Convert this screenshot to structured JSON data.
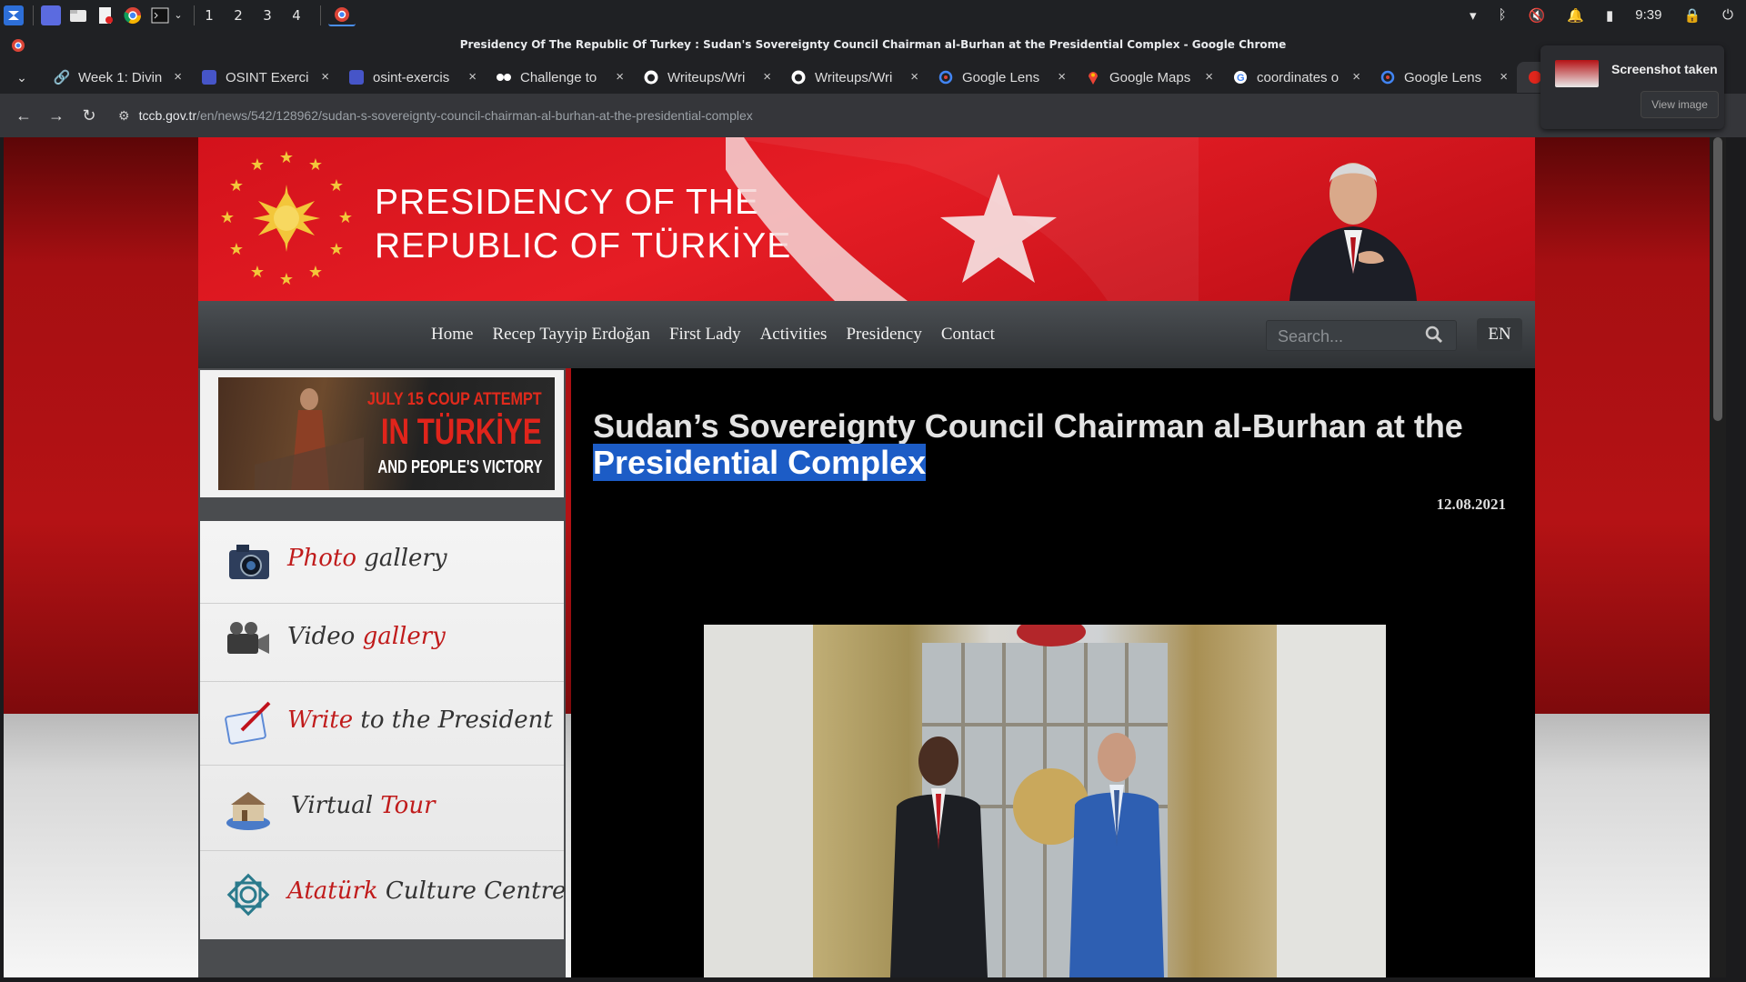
{
  "taskbar": {
    "workspaces": [
      "1",
      "2",
      "3",
      "4"
    ],
    "time": "9:39"
  },
  "window": {
    "title": "Presidency Of The Republic Of Turkey : Sudan's Sovereignty Council Chairman al-Burhan at the Presidential Complex - Google Chrome"
  },
  "tabs": [
    {
      "label": "Week 1: Divin",
      "icon": "link-icon"
    },
    {
      "label": "OSINT Exerci",
      "icon": "osint-icon"
    },
    {
      "label": "osint-exercis",
      "icon": "osint-icon"
    },
    {
      "label": "Challenge to",
      "icon": "challenge-icon"
    },
    {
      "label": "Writeups/Wri",
      "icon": "github-icon"
    },
    {
      "label": "Writeups/Wri",
      "icon": "github-icon"
    },
    {
      "label": "Google Lens",
      "icon": "google-lens-icon"
    },
    {
      "label": "Google Maps",
      "icon": "google-maps-icon"
    },
    {
      "label": "coordinates o",
      "icon": "google-icon"
    },
    {
      "label": "Google Lens",
      "icon": "google-lens-icon"
    }
  ],
  "address": {
    "host": "tccb.gov.tr",
    "path": "/en/news/542/128962/sudan-s-sovereignty-council-chairman-al-burhan-at-the-presidential-complex"
  },
  "toast": {
    "title": "Screenshot taken",
    "button": "View image"
  },
  "site": {
    "brand_line1": "PRESIDENCY OF THE",
    "brand_line2": "REPUBLIC OF TÜRKİYE",
    "menu": [
      "Home",
      "Recep Tayyip Erdoğan",
      "First Lady",
      "Activities",
      "Presidency",
      "Contact"
    ],
    "search_placeholder": "Search...",
    "language": "EN",
    "banner": {
      "line1": "JULY 15 COUP ATTEMPT",
      "line2": "IN TÜRKİYE",
      "line3": "AND PEOPLE'S VICTORY"
    },
    "links": [
      {
        "red": "Photo",
        "plain": " gallery",
        "red_first": true,
        "icon": "camera-icon"
      },
      {
        "red": "gallery",
        "plain": "Video ",
        "red_first": false,
        "icon": "video-camera-icon"
      },
      {
        "red": "Write",
        "plain": " to the President",
        "red_first": true,
        "icon": "letter-pen-icon"
      },
      {
        "red": "Tour",
        "plain": "Virtual ",
        "red_first": false,
        "icon": "building-icon"
      },
      {
        "red": "Atatürk",
        "plain": " Culture Centre",
        "red_first": true,
        "icon": "knot-ornament-icon"
      }
    ],
    "article": {
      "title_plain": "Sudan’s Sovereignty Council Chairman al-Burhan at the ",
      "title_highlighted": "Presidential Complex",
      "date": "12.08.2021"
    }
  },
  "colors": {
    "accent_red": "#c01b1b",
    "selection": "#1c5cc6",
    "header_red": "#e61d25"
  }
}
